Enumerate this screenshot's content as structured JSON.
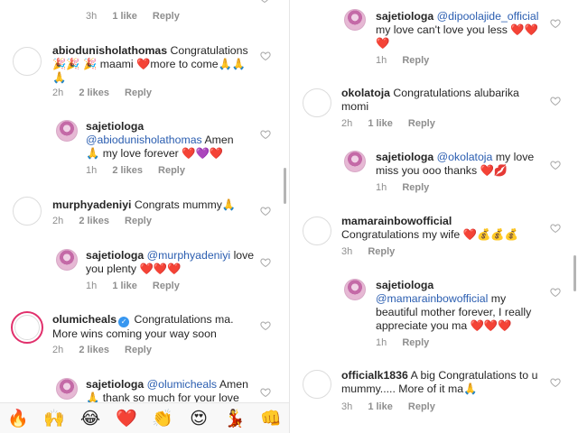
{
  "left": {
    "top_meta": {
      "time": "3h",
      "likes": "1 like",
      "reply": "Reply"
    },
    "comments": [
      {
        "user": "abiodunisholathomas",
        "text": "Congratulations 🎉🎉 🎉 maami ❤️more to come🙏🙏",
        "text2": "🙏",
        "time": "2h",
        "likes": "2 likes",
        "reply": "Reply"
      },
      {
        "user": "sajetiologa",
        "mention": "@abiodunisholathomas",
        "text": "Amen",
        "text2": "🙏 my love forever ❤️💜❤️",
        "time": "1h",
        "likes": "2 likes",
        "reply": "Reply"
      },
      {
        "user": "murphyadeniyi",
        "text": "Congrats mummy🙏",
        "time": "2h",
        "likes": "2 likes",
        "reply": "Reply"
      },
      {
        "user": "sajetiologa",
        "mention": "@murphyadeniyi",
        "text": "love",
        "text2": "you plenty ❤️❤️❤️",
        "time": "1h",
        "likes": "1 like",
        "reply": "Reply"
      },
      {
        "user": "olumicheals",
        "text": "Congratulations ma.",
        "text2": "More wins coming your way soon",
        "time": "2h",
        "likes": "2 likes",
        "reply": "Reply"
      },
      {
        "user": "sajetiologa",
        "mention": "@olumicheals",
        "text": "Amen",
        "text2": "🙏 thank so much for your love"
      }
    ],
    "emoji_bar": [
      "🔥",
      "🙌",
      "😂",
      "❤️",
      "👏",
      "😍",
      "💃",
      "👊"
    ]
  },
  "right": {
    "comments": [
      {
        "user": "sajetiologa",
        "mention": "@dipoolajide_official",
        "text": "",
        "text2": "my love can't love you less ❤️❤️",
        "text3": "❤️",
        "time": "1h",
        "reply": "Reply"
      },
      {
        "user": "okolatoja",
        "text": "Congratulations alubarika",
        "text2": "momi",
        "time": "2h",
        "likes": "1 like",
        "reply": "Reply"
      },
      {
        "user": "sajetiologa",
        "mention": "@okolatoja",
        "text": "my love",
        "text2": "miss you ooo thanks ❤️💋",
        "time": "1h",
        "reply": "Reply"
      },
      {
        "user": "mamarainbowofficial",
        "text": "",
        "text2": "Congratulations my wife ❤️💰💰💰",
        "time": "3h",
        "reply": "Reply"
      },
      {
        "user": "sajetiologa",
        "mention": "@mamarainbowofficial",
        "text": "my",
        "text2": "beautiful mother forever, I really",
        "text3": "appreciate you ma ❤️❤️❤️",
        "time": "1h",
        "reply": "Reply"
      },
      {
        "user": "officialk1836",
        "text": "A big Congratulations to u",
        "text2": "mummy..... More of it ma🙏",
        "time": "3h",
        "likes": "1 like",
        "reply": "Reply"
      }
    ]
  },
  "icons": {
    "heart": "heart-outline-icon",
    "verified": "verified-badge-icon"
  },
  "colors": {
    "mention": "#2a5db0",
    "muted": "#8e8e8e",
    "story_ring": "#e1306c",
    "verified": "#3897f0"
  }
}
